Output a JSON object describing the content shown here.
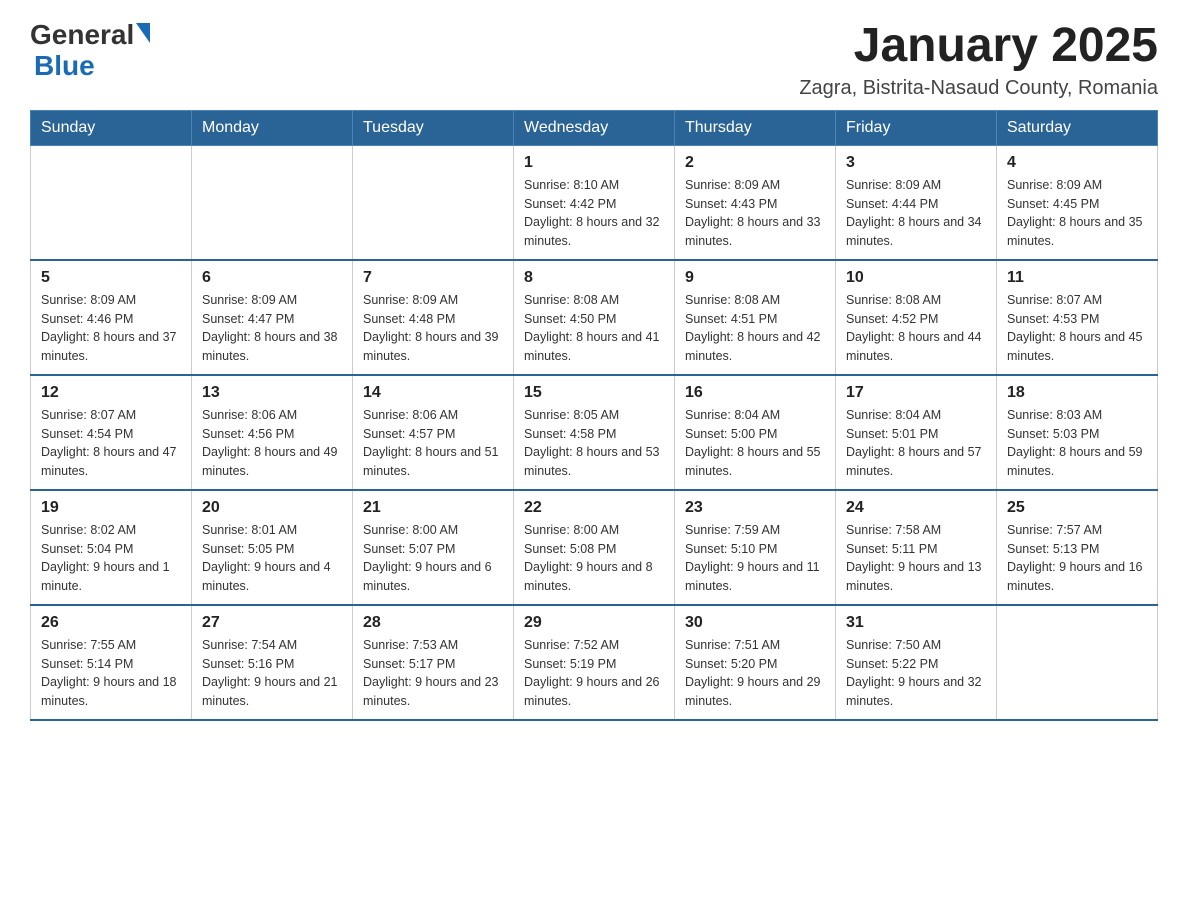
{
  "logo": {
    "general": "General",
    "triangle": "▶",
    "blue": "Blue"
  },
  "title": "January 2025",
  "subtitle": "Zagra, Bistrita-Nasaud County, Romania",
  "headers": [
    "Sunday",
    "Monday",
    "Tuesday",
    "Wednesday",
    "Thursday",
    "Friday",
    "Saturday"
  ],
  "weeks": [
    [
      {
        "day": "",
        "info": ""
      },
      {
        "day": "",
        "info": ""
      },
      {
        "day": "",
        "info": ""
      },
      {
        "day": "1",
        "info": "Sunrise: 8:10 AM\nSunset: 4:42 PM\nDaylight: 8 hours and 32 minutes."
      },
      {
        "day": "2",
        "info": "Sunrise: 8:09 AM\nSunset: 4:43 PM\nDaylight: 8 hours and 33 minutes."
      },
      {
        "day": "3",
        "info": "Sunrise: 8:09 AM\nSunset: 4:44 PM\nDaylight: 8 hours and 34 minutes."
      },
      {
        "day": "4",
        "info": "Sunrise: 8:09 AM\nSunset: 4:45 PM\nDaylight: 8 hours and 35 minutes."
      }
    ],
    [
      {
        "day": "5",
        "info": "Sunrise: 8:09 AM\nSunset: 4:46 PM\nDaylight: 8 hours and 37 minutes."
      },
      {
        "day": "6",
        "info": "Sunrise: 8:09 AM\nSunset: 4:47 PM\nDaylight: 8 hours and 38 minutes."
      },
      {
        "day": "7",
        "info": "Sunrise: 8:09 AM\nSunset: 4:48 PM\nDaylight: 8 hours and 39 minutes."
      },
      {
        "day": "8",
        "info": "Sunrise: 8:08 AM\nSunset: 4:50 PM\nDaylight: 8 hours and 41 minutes."
      },
      {
        "day": "9",
        "info": "Sunrise: 8:08 AM\nSunset: 4:51 PM\nDaylight: 8 hours and 42 minutes."
      },
      {
        "day": "10",
        "info": "Sunrise: 8:08 AM\nSunset: 4:52 PM\nDaylight: 8 hours and 44 minutes."
      },
      {
        "day": "11",
        "info": "Sunrise: 8:07 AM\nSunset: 4:53 PM\nDaylight: 8 hours and 45 minutes."
      }
    ],
    [
      {
        "day": "12",
        "info": "Sunrise: 8:07 AM\nSunset: 4:54 PM\nDaylight: 8 hours and 47 minutes."
      },
      {
        "day": "13",
        "info": "Sunrise: 8:06 AM\nSunset: 4:56 PM\nDaylight: 8 hours and 49 minutes."
      },
      {
        "day": "14",
        "info": "Sunrise: 8:06 AM\nSunset: 4:57 PM\nDaylight: 8 hours and 51 minutes."
      },
      {
        "day": "15",
        "info": "Sunrise: 8:05 AM\nSunset: 4:58 PM\nDaylight: 8 hours and 53 minutes."
      },
      {
        "day": "16",
        "info": "Sunrise: 8:04 AM\nSunset: 5:00 PM\nDaylight: 8 hours and 55 minutes."
      },
      {
        "day": "17",
        "info": "Sunrise: 8:04 AM\nSunset: 5:01 PM\nDaylight: 8 hours and 57 minutes."
      },
      {
        "day": "18",
        "info": "Sunrise: 8:03 AM\nSunset: 5:03 PM\nDaylight: 8 hours and 59 minutes."
      }
    ],
    [
      {
        "day": "19",
        "info": "Sunrise: 8:02 AM\nSunset: 5:04 PM\nDaylight: 9 hours and 1 minute."
      },
      {
        "day": "20",
        "info": "Sunrise: 8:01 AM\nSunset: 5:05 PM\nDaylight: 9 hours and 4 minutes."
      },
      {
        "day": "21",
        "info": "Sunrise: 8:00 AM\nSunset: 5:07 PM\nDaylight: 9 hours and 6 minutes."
      },
      {
        "day": "22",
        "info": "Sunrise: 8:00 AM\nSunset: 5:08 PM\nDaylight: 9 hours and 8 minutes."
      },
      {
        "day": "23",
        "info": "Sunrise: 7:59 AM\nSunset: 5:10 PM\nDaylight: 9 hours and 11 minutes."
      },
      {
        "day": "24",
        "info": "Sunrise: 7:58 AM\nSunset: 5:11 PM\nDaylight: 9 hours and 13 minutes."
      },
      {
        "day": "25",
        "info": "Sunrise: 7:57 AM\nSunset: 5:13 PM\nDaylight: 9 hours and 16 minutes."
      }
    ],
    [
      {
        "day": "26",
        "info": "Sunrise: 7:55 AM\nSunset: 5:14 PM\nDaylight: 9 hours and 18 minutes."
      },
      {
        "day": "27",
        "info": "Sunrise: 7:54 AM\nSunset: 5:16 PM\nDaylight: 9 hours and 21 minutes."
      },
      {
        "day": "28",
        "info": "Sunrise: 7:53 AM\nSunset: 5:17 PM\nDaylight: 9 hours and 23 minutes."
      },
      {
        "day": "29",
        "info": "Sunrise: 7:52 AM\nSunset: 5:19 PM\nDaylight: 9 hours and 26 minutes."
      },
      {
        "day": "30",
        "info": "Sunrise: 7:51 AM\nSunset: 5:20 PM\nDaylight: 9 hours and 29 minutes."
      },
      {
        "day": "31",
        "info": "Sunrise: 7:50 AM\nSunset: 5:22 PM\nDaylight: 9 hours and 32 minutes."
      },
      {
        "day": "",
        "info": ""
      }
    ]
  ]
}
